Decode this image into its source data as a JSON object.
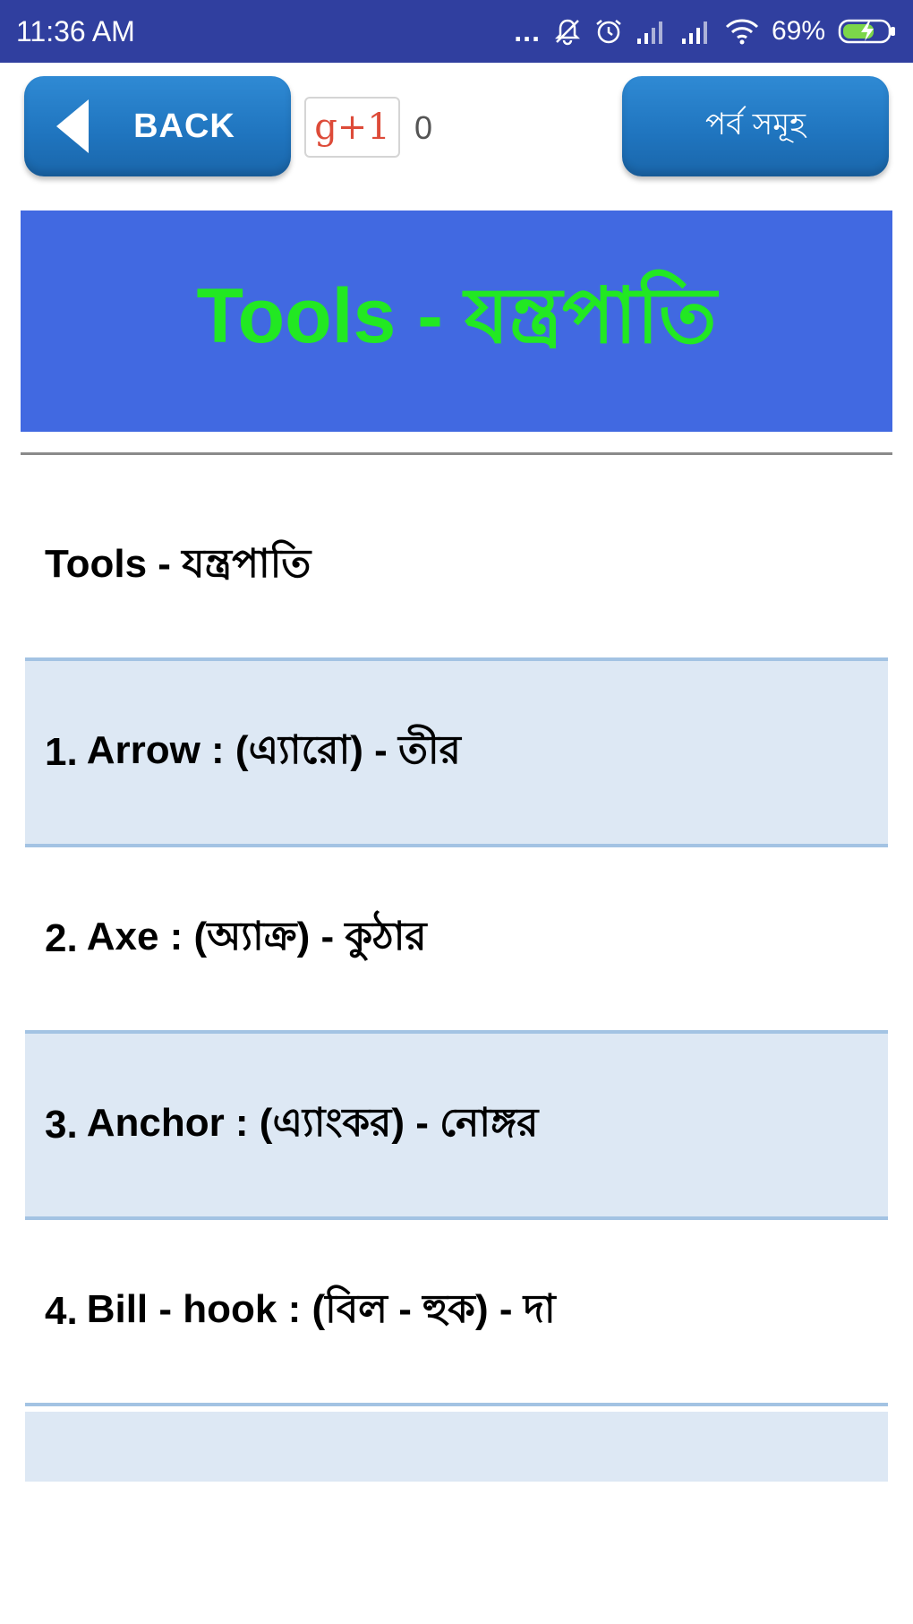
{
  "status_bar": {
    "time": "11:36 AM",
    "dots": "...",
    "battery_percent": "69%",
    "icons": [
      "more-dots-icon",
      "mute-icon",
      "alarm-icon",
      "signal-icon",
      "signal-icon",
      "wifi-icon",
      "battery-charging-icon"
    ]
  },
  "toolbar": {
    "back_label": "BACK",
    "gplus_label": "g+1",
    "gplus_count": "0",
    "episodes_label": "পর্ব সমূহ"
  },
  "header": {
    "title": "Tools - যন্ত্রপাতি",
    "banner_color": "#4169e1",
    "title_color": "#22e822"
  },
  "list": {
    "heading": "Tools - যন্ত্রপাতি",
    "items": [
      {
        "num": "1.",
        "text": "Arrow : (এ্যারো) - তীর"
      },
      {
        "num": "2.",
        "text": "Axe : (অ্যাক্র) - কুঠার"
      },
      {
        "num": "3.",
        "text": "Anchor : (এ্যাংকর) - নোঙ্গর"
      },
      {
        "num": "4.",
        "text": "Bill - hook : (বিল - হুক) - দা"
      }
    ]
  }
}
